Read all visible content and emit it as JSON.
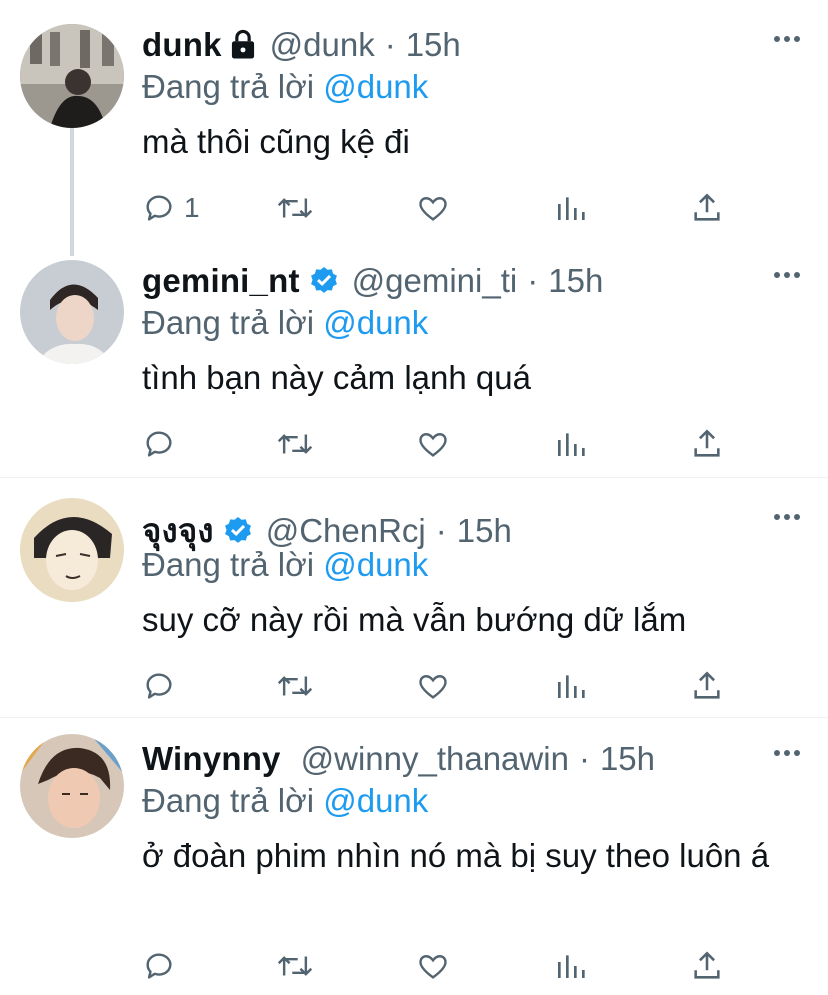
{
  "tweets": [
    {
      "name": "dunk",
      "handle": "@dunk",
      "dot": "·",
      "time": "15h",
      "reply_prefix": "Đang trả lời",
      "reply_to": "@dunk",
      "text": "mà thôi cũng kệ đi",
      "reply_count": "1",
      "protected": true,
      "avatar_colors": [
        "#2b2b2b",
        "#8d8a84"
      ]
    },
    {
      "name": "gemini_nt",
      "handle": "@gemini_ti",
      "dot": "·",
      "time": "15h",
      "reply_prefix": "Đang trả lời",
      "reply_to": "@dunk",
      "text": "tình bạn này cảm lạnh quá",
      "reply_count": "",
      "verified": true,
      "avatar_colors": [
        "#b9c1c8",
        "#e6d3c7"
      ]
    },
    {
      "name": "จุงจุง",
      "handle": "@ChenRcj",
      "dot": "·",
      "time": "15h",
      "reply_prefix": "Đang trả lời",
      "reply_to": "@dunk",
      "text": "suy cỡ này rồi mà vẫn bướng dữ lắm",
      "reply_count": "",
      "verified": true,
      "avatar_colors": [
        "#f2e6c8",
        "#2c2a2a"
      ]
    },
    {
      "name": "Winynny",
      "handle": "@winny_thanawin",
      "dot": "·",
      "time": "15h",
      "reply_prefix": "Đang trả lời",
      "reply_to": "@dunk",
      "text": "ở đoàn phim nhìn nó mà bị suy theo luôn á",
      "reply_count": "",
      "avatar_colors": [
        "#e8b9a3",
        "#4a3a30"
      ]
    }
  ],
  "colors": {
    "accent": "#1d9bf0",
    "secondary_text": "#536471",
    "primary_text": "#0f1419"
  },
  "icons": [
    "reply-icon",
    "retweet-icon",
    "like-icon",
    "analytics-icon",
    "share-icon",
    "more-icon",
    "verified-badge-icon",
    "lock-icon"
  ]
}
